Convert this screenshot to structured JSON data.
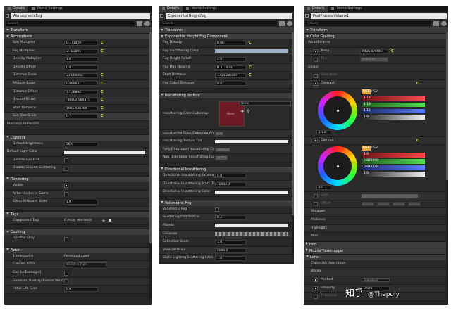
{
  "tabs": {
    "details": "Details",
    "world_settings": "World Settings"
  },
  "search": {
    "placeholder": "Search"
  },
  "p1": {
    "name": "AtmosphericFog",
    "transform": "Transform",
    "atmosphere": "Atmosphere",
    "atm_rows": [
      {
        "label": "Sun Multiplier",
        "value": "0.171429"
      },
      {
        "label": "Fog Multiplier",
        "value": "2.183801"
      },
      {
        "label": "Density Multiplier",
        "value": "1.0"
      },
      {
        "label": "Density Offset",
        "value": "0.0"
      },
      {
        "label": "Distance Scale",
        "value": "21.666092"
      },
      {
        "label": "Altitude Scale",
        "value": "0.890631"
      },
      {
        "label": "Distance Offset",
        "value": "7.756892"
      },
      {
        "label": "Ground Offset",
        "value": "-98402.984375"
      },
      {
        "label": "Start Distance",
        "value": "1985.038364"
      },
      {
        "label": "Sun Disc Scale",
        "value": "0.7"
      }
    ],
    "precompute": "Precompute Params",
    "lighting": "Lighting",
    "default_brightness": {
      "label": "Default Brightness",
      "value": "50.0"
    },
    "default_light_color": "Default Light Color",
    "disable_sun_disk": "Disable Sun Disk",
    "disable_ground_scattering": "Disable Ground Scattering",
    "rendering": "Rendering",
    "visible": "Visible",
    "actor_hidden": "Actor Hidden in Game",
    "billboard": {
      "label": "Editor Billboard Scale",
      "value": "1.0"
    },
    "tags": "Tags",
    "component_tags": {
      "label": "Component Tags",
      "value": "0 Array elements"
    },
    "cooking": "Cooking",
    "editor_only": "Is Editor Only",
    "actor": "Actor",
    "selected": {
      "label": "1 selected in",
      "value": "Persistent Level"
    },
    "convert_actor": {
      "label": "Convert Actor",
      "value": "Select a Type"
    },
    "can_be_damaged": "Can be Damaged",
    "generate_overlap": "Generate Overlap Events During",
    "initial_life_span": {
      "label": "Initial Life Span",
      "value": "0.0"
    }
  },
  "p2": {
    "name": "ExponentialHeightFog",
    "transform": "Transform",
    "ehf": "Exponential Height Fog Component",
    "ehf_rows": [
      {
        "label": "Fog Density",
        "value": "0.06"
      },
      {
        "label": "Fog Inscattering Color",
        "value": ""
      },
      {
        "label": "Fog Height Falloff",
        "value": "2.0"
      },
      {
        "label": "Fog Max Opacity",
        "value": "0.371429"
      },
      {
        "label": "Start Distance",
        "value": "1714.285889"
      },
      {
        "label": "Fog Cutoff Distance",
        "value": "0.0"
      }
    ],
    "inscat_tex": "Inscattering Texture",
    "cubemap": {
      "label": "Inscattering Color Cubemap",
      "value": "None"
    },
    "tex_rows": [
      {
        "label": "Inscattering Color Cubemap An",
        "value": "0.0"
      },
      {
        "label": "Inscattering Texture Tint",
        "value": ""
      },
      {
        "label": "Fully Directional Inscattering Co",
        "value": "100000.0"
      },
      {
        "label": "Non Directional Inscattering Co",
        "value": "1000.0"
      }
    ],
    "dir_inscat": "Directional Inscattering",
    "dir_rows": [
      {
        "label": "Directional Inscattering Expone",
        "value": "4.0"
      },
      {
        "label": "Directional Inscattering Start Di",
        "value": "10000.0"
      },
      {
        "label": "Directional Inscattering Color",
        "value": ""
      }
    ],
    "vol_fog": "Volumetric Fog",
    "vol_rows": [
      {
        "label": "Volumetric Fog",
        "value": ""
      },
      {
        "label": "Scattering Distribution",
        "value": "0.2"
      },
      {
        "label": "Albedo",
        "value": ""
      },
      {
        "label": "Emissive",
        "value": ""
      },
      {
        "label": "Extinction Scale",
        "value": "1.0"
      },
      {
        "label": "View Distance",
        "value": "6000.0"
      },
      {
        "label": "Static Lighting Scattering Inten",
        "value": "1.0"
      }
    ]
  },
  "p3": {
    "name": "PostProcessVolume1",
    "transform": "Transform",
    "color_grading": "Color Grading",
    "white_balance": "WhiteBalance",
    "temp": {
      "label": "Temp",
      "value": "6426.978907"
    },
    "tint": {
      "label": "Tint",
      "value": "0.02431"
    },
    "global": "Global",
    "saturation": "Saturation",
    "contrast": "Contrast",
    "rgb": "RGB",
    "hsv": "HSV",
    "contrast_channels": [
      "1.13",
      "1.13",
      "1.13",
      "1.0"
    ],
    "contrast_value": "1.13",
    "gamma": "Gamma",
    "gamma_channels": [
      "1.0",
      "0.870998",
      "0.842218",
      "1.0"
    ],
    "gamma_value": "1.0",
    "gain": "Gain",
    "offset": "Offset",
    "shadows": "Shadows",
    "midtones": "Midtones",
    "highlights": "Highlights",
    "misc": "Misc",
    "film": "Film",
    "mobile_tonemapper": "Mobile Tonemapper",
    "lens": "Lens",
    "chromatic": "Chromatic Aberration",
    "bloom": "Bloom",
    "method": {
      "label": "Method",
      "value": "Standard"
    },
    "intensity": {
      "label": "Intensity",
      "value": "0.675"
    },
    "threshold": {
      "label": "Threshold",
      "value": ""
    }
  },
  "watermark": {
    "brand": "知乎",
    "handle": "@Thepoly"
  },
  "colors": {
    "panel": "#262626",
    "header": "#3c3c3c",
    "accent": "#e7a33a"
  }
}
